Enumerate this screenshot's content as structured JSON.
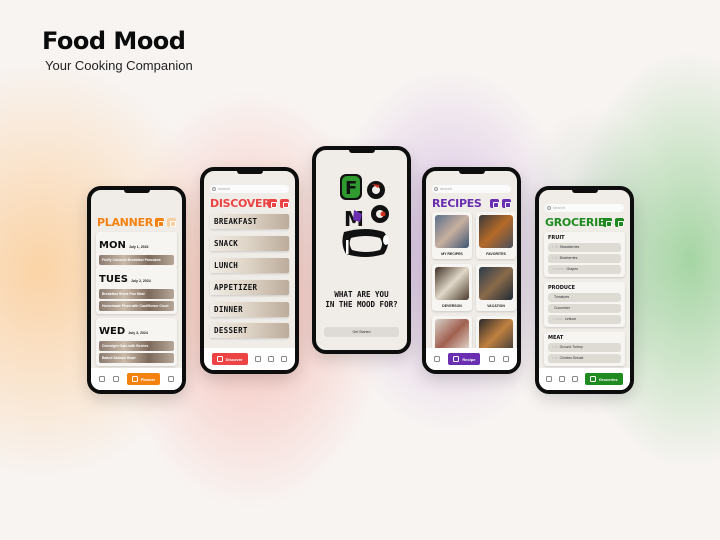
{
  "brand": {
    "title": "Food Mood",
    "subtitle": "Your Cooking Companion"
  },
  "colors": {
    "planner": "#f5820f",
    "discover": "#ec4444",
    "recipes": "#6a2fb0",
    "groceries": "#1f8a1f",
    "logo_green": "#2f9a2f",
    "logo_purple": "#6a2fb0",
    "logo_red": "#d03020"
  },
  "planner": {
    "title": "PLANNER",
    "days": [
      {
        "name": "MON",
        "date": "July 1, 2024",
        "meals": [
          "Fluffy Coconut Breakfast Pancakes"
        ]
      },
      {
        "name": "TUES",
        "date": "July 2, 2024",
        "meals": [
          "Breakfast Sheet Pan Meal",
          "Homemade Pizza with Cauliflower Crust"
        ]
      },
      {
        "name": "WED",
        "date": "July 3, 2024",
        "meals": [
          "Overnight Oats with Berries",
          "Baked Salmon Bowl"
        ]
      }
    ],
    "nav_active": "Planner"
  },
  "discover": {
    "search_placeholder": "search",
    "title": "DISCOVER",
    "categories": [
      "BREAKFAST",
      "SNACK",
      "LUNCH",
      "APPETIZER",
      "DINNER",
      "DESSERT"
    ],
    "nav_active": "Discover"
  },
  "landing": {
    "logo_letters": [
      "F",
      "O",
      "M",
      "O",
      "D"
    ],
    "question_line1": "WHAT ARE YOU",
    "question_line2": "IN THE MOOD FOR?",
    "cta": "Get Started"
  },
  "recipes": {
    "search_placeholder": "search",
    "title": "RECIPES",
    "collections": [
      "MY RECIPES",
      "FAVORITES",
      "DEVERSON",
      "VACATION",
      "",
      ""
    ],
    "nav_active": "Recipe"
  },
  "groceries": {
    "search_placeholder": "search",
    "title": "GROCERIES",
    "sections": [
      {
        "name": "FRUIT",
        "items": [
          {
            "qty": "1 lb",
            "name": "Strawberries"
          },
          {
            "qty": "1 lb",
            "name": "Blueberries"
          },
          {
            "qty": "1 bunch",
            "name": "Grapes"
          }
        ]
      },
      {
        "name": "PRODUCE",
        "items": [
          {
            "qty": "",
            "name": "Tomatoes"
          },
          {
            "qty": "",
            "name": "Cucumber"
          },
          {
            "qty": "1 head",
            "name": "Lettuce"
          }
        ]
      },
      {
        "name": "MEAT",
        "items": [
          {
            "qty": "1 lb",
            "name": "Ground Turkey"
          },
          {
            "qty": "1 lb",
            "name": "Chicken Breast"
          }
        ]
      }
    ],
    "nav_active": "Groceries"
  }
}
